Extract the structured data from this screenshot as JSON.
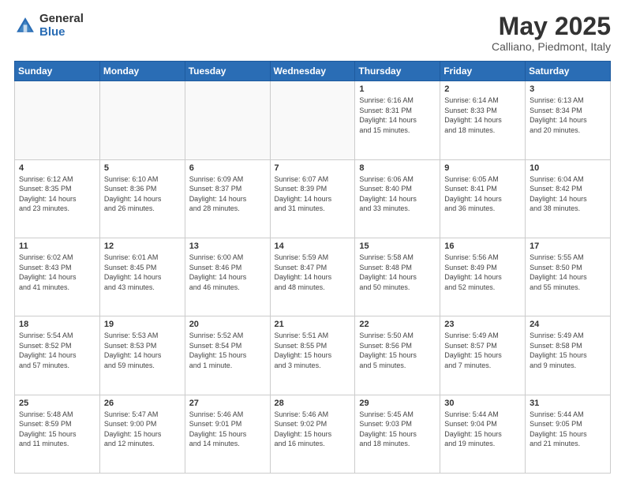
{
  "header": {
    "logo_general": "General",
    "logo_blue": "Blue",
    "title": "May 2025",
    "location": "Calliano, Piedmont, Italy"
  },
  "days_of_week": [
    "Sunday",
    "Monday",
    "Tuesday",
    "Wednesday",
    "Thursday",
    "Friday",
    "Saturday"
  ],
  "weeks": [
    [
      {
        "day": "",
        "info": ""
      },
      {
        "day": "",
        "info": ""
      },
      {
        "day": "",
        "info": ""
      },
      {
        "day": "",
        "info": ""
      },
      {
        "day": "1",
        "info": "Sunrise: 6:16 AM\nSunset: 8:31 PM\nDaylight: 14 hours\nand 15 minutes."
      },
      {
        "day": "2",
        "info": "Sunrise: 6:14 AM\nSunset: 8:33 PM\nDaylight: 14 hours\nand 18 minutes."
      },
      {
        "day": "3",
        "info": "Sunrise: 6:13 AM\nSunset: 8:34 PM\nDaylight: 14 hours\nand 20 minutes."
      }
    ],
    [
      {
        "day": "4",
        "info": "Sunrise: 6:12 AM\nSunset: 8:35 PM\nDaylight: 14 hours\nand 23 minutes."
      },
      {
        "day": "5",
        "info": "Sunrise: 6:10 AM\nSunset: 8:36 PM\nDaylight: 14 hours\nand 26 minutes."
      },
      {
        "day": "6",
        "info": "Sunrise: 6:09 AM\nSunset: 8:37 PM\nDaylight: 14 hours\nand 28 minutes."
      },
      {
        "day": "7",
        "info": "Sunrise: 6:07 AM\nSunset: 8:39 PM\nDaylight: 14 hours\nand 31 minutes."
      },
      {
        "day": "8",
        "info": "Sunrise: 6:06 AM\nSunset: 8:40 PM\nDaylight: 14 hours\nand 33 minutes."
      },
      {
        "day": "9",
        "info": "Sunrise: 6:05 AM\nSunset: 8:41 PM\nDaylight: 14 hours\nand 36 minutes."
      },
      {
        "day": "10",
        "info": "Sunrise: 6:04 AM\nSunset: 8:42 PM\nDaylight: 14 hours\nand 38 minutes."
      }
    ],
    [
      {
        "day": "11",
        "info": "Sunrise: 6:02 AM\nSunset: 8:43 PM\nDaylight: 14 hours\nand 41 minutes."
      },
      {
        "day": "12",
        "info": "Sunrise: 6:01 AM\nSunset: 8:45 PM\nDaylight: 14 hours\nand 43 minutes."
      },
      {
        "day": "13",
        "info": "Sunrise: 6:00 AM\nSunset: 8:46 PM\nDaylight: 14 hours\nand 46 minutes."
      },
      {
        "day": "14",
        "info": "Sunrise: 5:59 AM\nSunset: 8:47 PM\nDaylight: 14 hours\nand 48 minutes."
      },
      {
        "day": "15",
        "info": "Sunrise: 5:58 AM\nSunset: 8:48 PM\nDaylight: 14 hours\nand 50 minutes."
      },
      {
        "day": "16",
        "info": "Sunrise: 5:56 AM\nSunset: 8:49 PM\nDaylight: 14 hours\nand 52 minutes."
      },
      {
        "day": "17",
        "info": "Sunrise: 5:55 AM\nSunset: 8:50 PM\nDaylight: 14 hours\nand 55 minutes."
      }
    ],
    [
      {
        "day": "18",
        "info": "Sunrise: 5:54 AM\nSunset: 8:52 PM\nDaylight: 14 hours\nand 57 minutes."
      },
      {
        "day": "19",
        "info": "Sunrise: 5:53 AM\nSunset: 8:53 PM\nDaylight: 14 hours\nand 59 minutes."
      },
      {
        "day": "20",
        "info": "Sunrise: 5:52 AM\nSunset: 8:54 PM\nDaylight: 15 hours\nand 1 minute."
      },
      {
        "day": "21",
        "info": "Sunrise: 5:51 AM\nSunset: 8:55 PM\nDaylight: 15 hours\nand 3 minutes."
      },
      {
        "day": "22",
        "info": "Sunrise: 5:50 AM\nSunset: 8:56 PM\nDaylight: 15 hours\nand 5 minutes."
      },
      {
        "day": "23",
        "info": "Sunrise: 5:49 AM\nSunset: 8:57 PM\nDaylight: 15 hours\nand 7 minutes."
      },
      {
        "day": "24",
        "info": "Sunrise: 5:49 AM\nSunset: 8:58 PM\nDaylight: 15 hours\nand 9 minutes."
      }
    ],
    [
      {
        "day": "25",
        "info": "Sunrise: 5:48 AM\nSunset: 8:59 PM\nDaylight: 15 hours\nand 11 minutes."
      },
      {
        "day": "26",
        "info": "Sunrise: 5:47 AM\nSunset: 9:00 PM\nDaylight: 15 hours\nand 12 minutes."
      },
      {
        "day": "27",
        "info": "Sunrise: 5:46 AM\nSunset: 9:01 PM\nDaylight: 15 hours\nand 14 minutes."
      },
      {
        "day": "28",
        "info": "Sunrise: 5:46 AM\nSunset: 9:02 PM\nDaylight: 15 hours\nand 16 minutes."
      },
      {
        "day": "29",
        "info": "Sunrise: 5:45 AM\nSunset: 9:03 PM\nDaylight: 15 hours\nand 18 minutes."
      },
      {
        "day": "30",
        "info": "Sunrise: 5:44 AM\nSunset: 9:04 PM\nDaylight: 15 hours\nand 19 minutes."
      },
      {
        "day": "31",
        "info": "Sunrise: 5:44 AM\nSunset: 9:05 PM\nDaylight: 15 hours\nand 21 minutes."
      }
    ]
  ]
}
